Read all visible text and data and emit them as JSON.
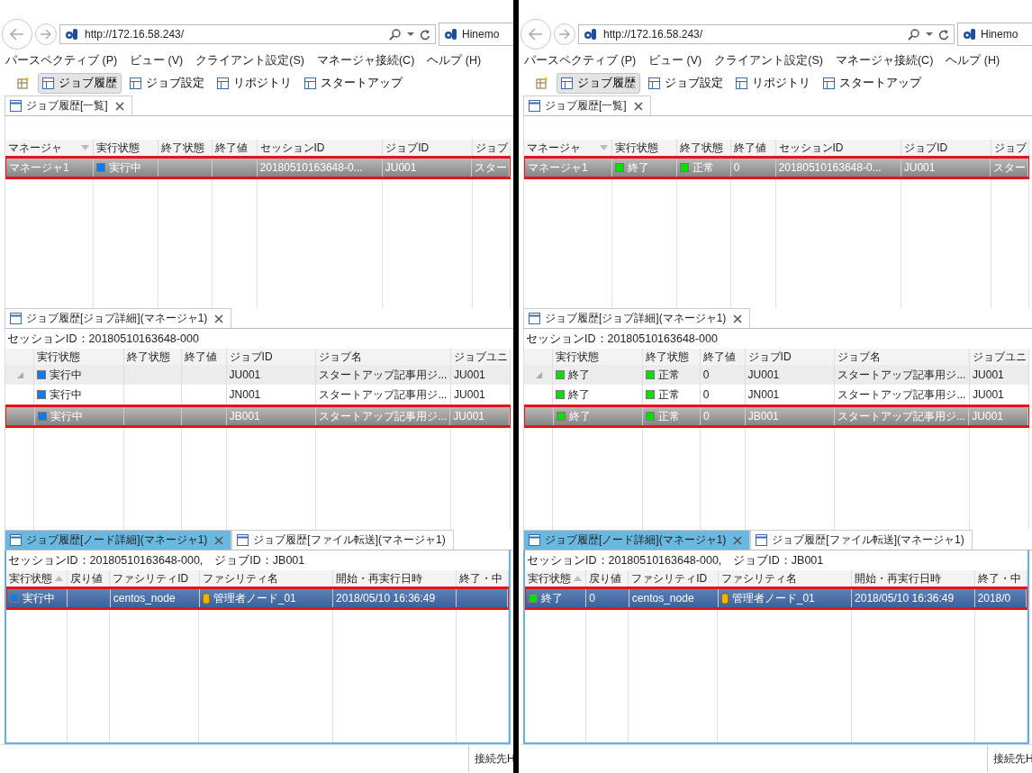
{
  "screens": [
    {
      "browser": {
        "url": "http://172.16.58.243/",
        "tab": "Hinemo"
      },
      "menu": [
        "パースペクティブ (P)",
        "ビュー (V)",
        "クライアント設定(S)",
        "マネージャ接続(C)",
        "ヘルプ (H)"
      ],
      "toolbar": [
        {
          "label": "ジョブ履歴",
          "selected": true
        },
        {
          "label": "ジョブ設定",
          "selected": false
        },
        {
          "label": "リポジトリ",
          "selected": false
        },
        {
          "label": "スタートアップ",
          "selected": false
        }
      ],
      "views": [
        {
          "kind": "list",
          "active": false,
          "tabs": [
            {
              "label": "ジョブ履歴[一覧]",
              "selected": true
            }
          ],
          "columns": [
            {
              "label": "マネージャ",
              "sorted": true,
              "descending": true
            },
            {
              "label": "実行状態",
              "sorted": false
            },
            {
              "label": "終了状態",
              "sorted": false
            },
            {
              "label": "終了値",
              "sorted": false
            },
            {
              "label": "セッションID",
              "sorted": false
            },
            {
              "label": "ジョブID",
              "sorted": false
            },
            {
              "label": "ジョブ",
              "sorted": false
            }
          ],
          "rows": [
            {
              "selected": true,
              "cells": [
                {
                  "text": "マネージャ1"
                },
                {
                  "text": "実行中",
                  "color": "#0a7cf0"
                },
                null,
                null,
                {
                  "text": "20180510163648-0..."
                },
                {
                  "text": "JU001"
                },
                {
                  "text": "スター"
                }
              ]
            }
          ]
        },
        {
          "kind": "tree",
          "active": false,
          "tabs": [
            {
              "label": "ジョブ履歴[ジョブ詳細](マネージャ1)",
              "selected": true
            }
          ],
          "session": "セッションID：20180510163648-000",
          "columns": [
            {
              "label": "実行状態"
            },
            {
              "label": "終了状態"
            },
            {
              "label": "終了値"
            },
            {
              "label": "ジョブID"
            },
            {
              "label": "ジョブ名"
            },
            {
              "label": "ジョブユニ"
            }
          ],
          "rows": [
            {
              "selected": false,
              "expanded": true,
              "cells": [
                {
                  "text": "実行中",
                  "color": "#0a7cf0"
                },
                null,
                null,
                {
                  "text": "JU001"
                },
                {
                  "text": "スタートアップ記事用ジ..."
                },
                {
                  "text": "JU001"
                }
              ],
              "children": [
                {
                  "selected": false,
                  "cells": [
                    {
                      "text": "実行中",
                      "color": "#0a7cf0"
                    },
                    null,
                    null,
                    {
                      "text": "JN001"
                    },
                    {
                      "text": "スタートアップ記事用ジ..."
                    },
                    {
                      "text": "JU001"
                    }
                  ]
                },
                {
                  "selected": true,
                  "cells": [
                    {
                      "text": "実行中",
                      "color": "#0a7cf0"
                    },
                    null,
                    null,
                    {
                      "text": "JB001"
                    },
                    {
                      "text": "スタートアップ記事用ジ..."
                    },
                    {
                      "text": "JU001"
                    }
                  ]
                }
              ]
            }
          ]
        },
        {
          "kind": "list",
          "active": true,
          "tabs": [
            {
              "label": "ジョブ履歴[ノード詳細](マネージャ1)",
              "selected": true
            },
            {
              "label": "ジョブ履歴[ファイル転送](マネージャ1)",
              "selected": false
            }
          ],
          "session": "セッションID：20180510163648-000,　ジョブID：JB001",
          "columns": [
            {
              "label": "実行状態",
              "sorted": true,
              "descending": false
            },
            {
              "label": "戻り値",
              "sorted": false
            },
            {
              "label": "ファシリティID",
              "sorted": false
            },
            {
              "label": "ファシリティ名",
              "sorted": false
            },
            {
              "label": "開始・再実行日時",
              "sorted": false
            },
            {
              "label": "終了・中",
              "sorted": false
            }
          ],
          "rows": [
            {
              "selected": true,
              "cells": [
                {
                  "text": "実行中",
                  "color": "#0a7cf0"
                },
                null,
                {
                  "text": "centos_node"
                },
                {
                  "text": "管理者ノード_01",
                  "kind": "node"
                },
                {
                  "text": "2018/05/10 16:36:49"
                },
                null
              ]
            }
          ]
        }
      ],
      "status_bar": "接続先H"
    },
    {
      "browser": {
        "url": "http://172.16.58.243/",
        "tab": "Hinemo"
      },
      "menu": [
        "パースペクティブ (P)",
        "ビュー (V)",
        "クライアント設定(S)",
        "マネージャ接続(C)",
        "ヘルプ (H)"
      ],
      "toolbar": [
        {
          "label": "ジョブ履歴",
          "selected": true
        },
        {
          "label": "ジョブ設定",
          "selected": false
        },
        {
          "label": "リポジトリ",
          "selected": false
        },
        {
          "label": "スタートアップ",
          "selected": false
        }
      ],
      "views": [
        {
          "kind": "list",
          "active": false,
          "tabs": [
            {
              "label": "ジョブ履歴[一覧]",
              "selected": true
            }
          ],
          "columns": [
            {
              "label": "マネージャ",
              "sorted": true,
              "descending": true
            },
            {
              "label": "実行状態",
              "sorted": false
            },
            {
              "label": "終了状態",
              "sorted": false
            },
            {
              "label": "終了値",
              "sorted": false
            },
            {
              "label": "セッションID",
              "sorted": false
            },
            {
              "label": "ジョブID",
              "sorted": false
            },
            {
              "label": "ジョブ",
              "sorted": false
            }
          ],
          "rows": [
            {
              "selected": true,
              "cells": [
                {
                  "text": "マネージャ1"
                },
                {
                  "text": "終了",
                  "color": "#00e000"
                },
                {
                  "text": "正常",
                  "color": "#00e000"
                },
                {
                  "text": "0"
                },
                {
                  "text": "20180510163648-0..."
                },
                {
                  "text": "JU001"
                },
                {
                  "text": "スター"
                }
              ]
            }
          ]
        },
        {
          "kind": "tree",
          "active": false,
          "tabs": [
            {
              "label": "ジョブ履歴[ジョブ詳細](マネージャ1)",
              "selected": true
            }
          ],
          "session": "セッションID：20180510163648-000",
          "columns": [
            {
              "label": "実行状態"
            },
            {
              "label": "終了状態"
            },
            {
              "label": "終了値"
            },
            {
              "label": "ジョブID"
            },
            {
              "label": "ジョブ名"
            },
            {
              "label": "ジョブユニ"
            }
          ],
          "rows": [
            {
              "selected": false,
              "expanded": true,
              "cells": [
                {
                  "text": "終了",
                  "color": "#00e000"
                },
                {
                  "text": "正常",
                  "color": "#00e000"
                },
                {
                  "text": "0"
                },
                {
                  "text": "JU001"
                },
                {
                  "text": "スタートアップ記事用ジ..."
                },
                {
                  "text": "JU001"
                }
              ],
              "children": [
                {
                  "selected": false,
                  "cells": [
                    {
                      "text": "終了",
                      "color": "#00e000"
                    },
                    {
                      "text": "正常",
                      "color": "#00e000"
                    },
                    {
                      "text": "0"
                    },
                    {
                      "text": "JN001"
                    },
                    {
                      "text": "スタートアップ記事用ジ..."
                    },
                    {
                      "text": "JU001"
                    }
                  ]
                },
                {
                  "selected": true,
                  "cells": [
                    {
                      "text": "終了",
                      "color": "#00e000"
                    },
                    {
                      "text": "正常",
                      "color": "#00e000"
                    },
                    {
                      "text": "0"
                    },
                    {
                      "text": "JB001"
                    },
                    {
                      "text": "スタートアップ記事用ジ..."
                    },
                    {
                      "text": "JU001"
                    }
                  ]
                }
              ]
            }
          ]
        },
        {
          "kind": "list",
          "active": true,
          "tabs": [
            {
              "label": "ジョブ履歴[ノード詳細](マネージャ1)",
              "selected": true
            },
            {
              "label": "ジョブ履歴[ファイル転送](マネージャ1)",
              "selected": false
            }
          ],
          "session": "セッションID：20180510163648-000,　ジョブID：JB001",
          "columns": [
            {
              "label": "実行状態",
              "sorted": true,
              "descending": false
            },
            {
              "label": "戻り値",
              "sorted": false
            },
            {
              "label": "ファシリティID",
              "sorted": false
            },
            {
              "label": "ファシリティ名",
              "sorted": false
            },
            {
              "label": "開始・再実行日時",
              "sorted": false
            },
            {
              "label": "終了・中",
              "sorted": false
            }
          ],
          "rows": [
            {
              "selected": true,
              "cells": [
                {
                  "text": "終了",
                  "color": "#00e000"
                },
                {
                  "text": "0"
                },
                {
                  "text": "centos_node"
                },
                {
                  "text": "管理者ノード_01",
                  "kind": "node"
                },
                {
                  "text": "2018/05/10 16:36:49"
                },
                {
                  "text": "2018/0"
                }
              ]
            }
          ]
        }
      ],
      "status_bar": "接続先H"
    }
  ]
}
